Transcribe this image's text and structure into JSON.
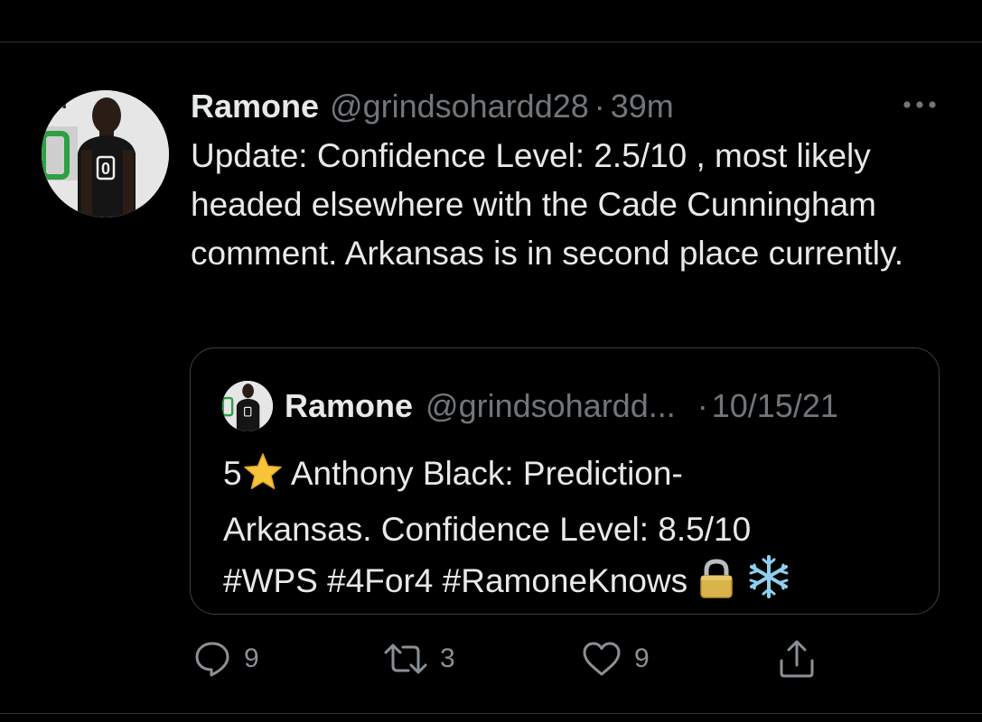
{
  "tweet": {
    "display_name": "Ramone",
    "handle": "@grindsohardd28",
    "separator": "·",
    "time": "39m",
    "text": "Update: Confidence Level: 2.5/10 , most likely headed elsewhere with the Cade Cunningham comment. Arkansas is in second place currently."
  },
  "quoted_tweet": {
    "display_name": "Ramone",
    "handle": "@grindsohardd...",
    "separator": "·",
    "date": "10/15/21",
    "text_number": "5",
    "text_line_1": "Anthony Black: Prediction-",
    "text_line_2": "Arkansas. Confidence Level: 8.5/10",
    "text_line_3": "#WPS #4For4 #RamoneKnows"
  },
  "actions": {
    "replies": "9",
    "retweets": "3",
    "likes": "9"
  },
  "icons": {
    "more": "more-horizontal-icon",
    "reply": "reply-icon",
    "retweet": "retweet-icon",
    "like": "heart-icon",
    "share": "share-icon",
    "emoji_star": "star-emoji",
    "emoji_lock": "lock-emoji",
    "emoji_snowflake": "snowflake-emoji"
  },
  "colors": {
    "background": "#000000",
    "text_primary": "#e7e9ea",
    "text_secondary": "#71767b",
    "border": "#2f3336"
  }
}
